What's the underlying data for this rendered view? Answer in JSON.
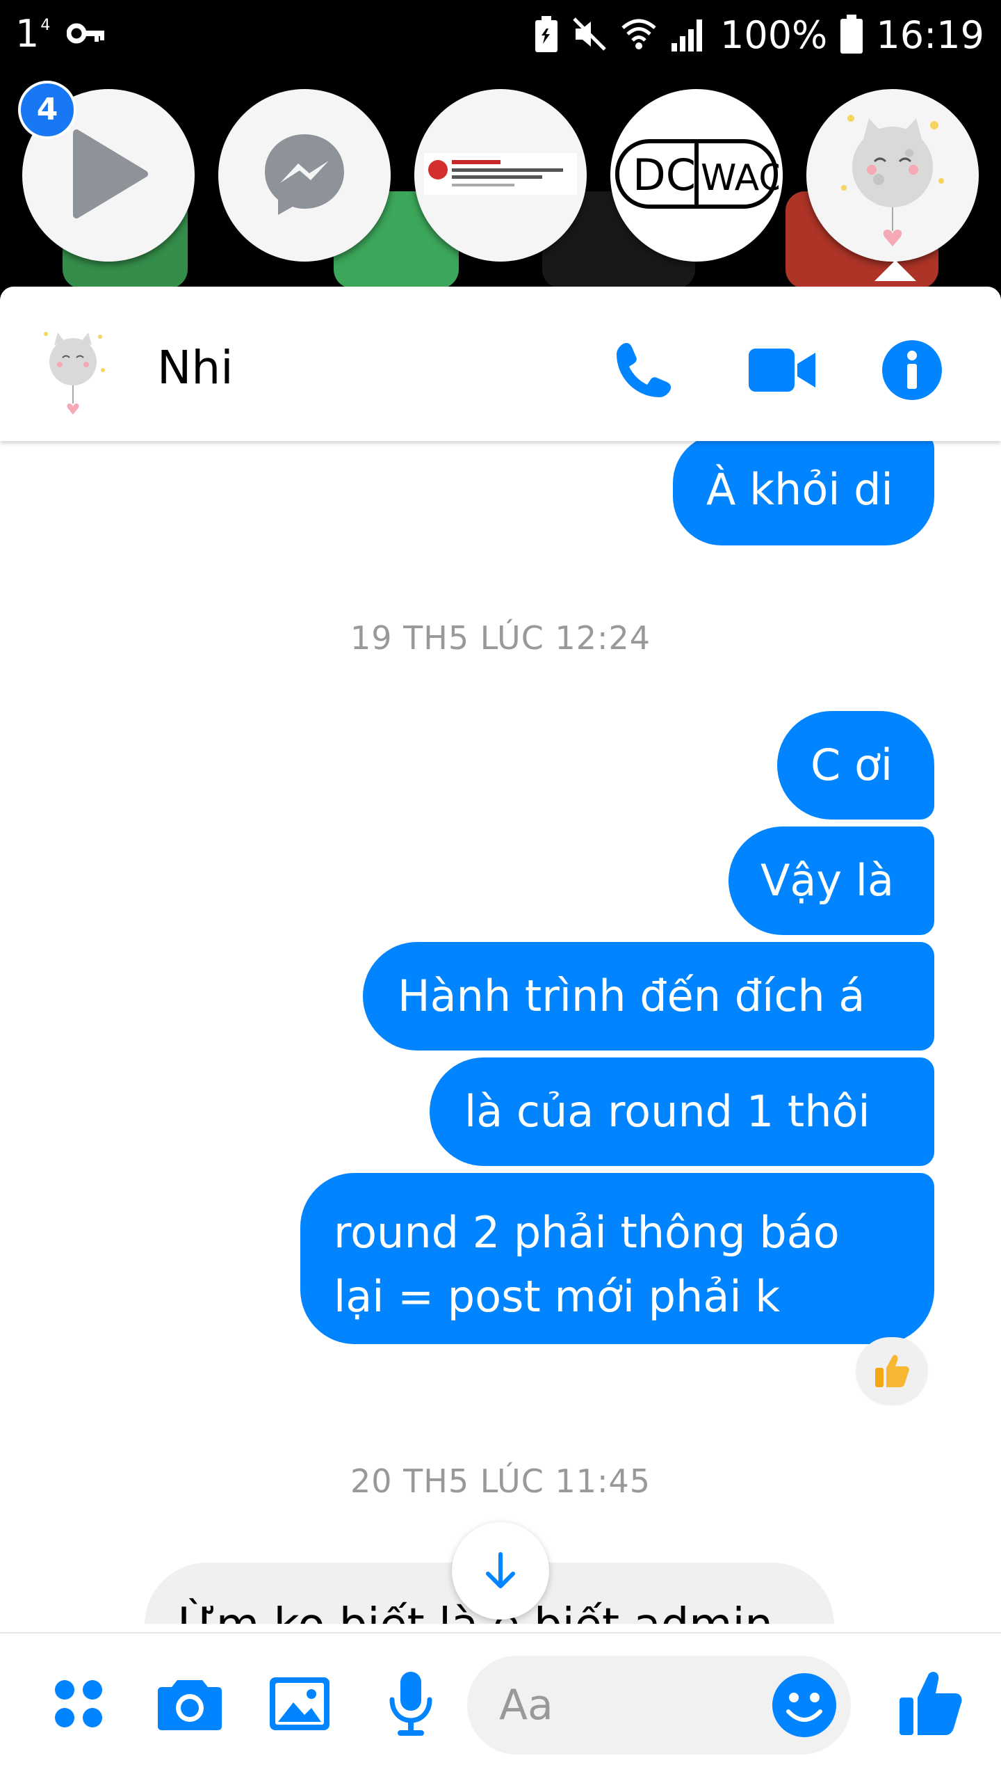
{
  "status_bar": {
    "notification_count": "1",
    "notification_superscript": "4",
    "battery": "100%",
    "time": "16:19"
  },
  "chat_heads": {
    "unread_badge": "4",
    "heads": [
      {
        "name": "play-head",
        "icon": "play-icon"
      },
      {
        "name": "messenger-head",
        "icon": "messenger-icon"
      },
      {
        "name": "post-preview-head",
        "icon": "post-thumbnail"
      },
      {
        "name": "dcwao-head",
        "logo_text": "DC WAO"
      },
      {
        "name": "nhi-head",
        "icon": "moon-cat-avatar"
      }
    ]
  },
  "chat_header": {
    "contact_name": "Nhi",
    "accent_color": "#0084ff"
  },
  "messages": {
    "first_outgoing": "À khỏi di",
    "timestamp_1": "19 TH5 LÚC 12:24",
    "outgoing": [
      "C ơi",
      "Vậy là",
      "Hành trình đến đích á",
      "là của round 1 thôi",
      "round 2 phải thông báo lại = post mới phải k"
    ],
    "reaction": "thumbs-up",
    "timestamp_2": "20 TH5 LÚC 11:45",
    "incoming_partial": "Ừm ko biết là e biết admin"
  },
  "composer": {
    "placeholder": "Aa"
  }
}
